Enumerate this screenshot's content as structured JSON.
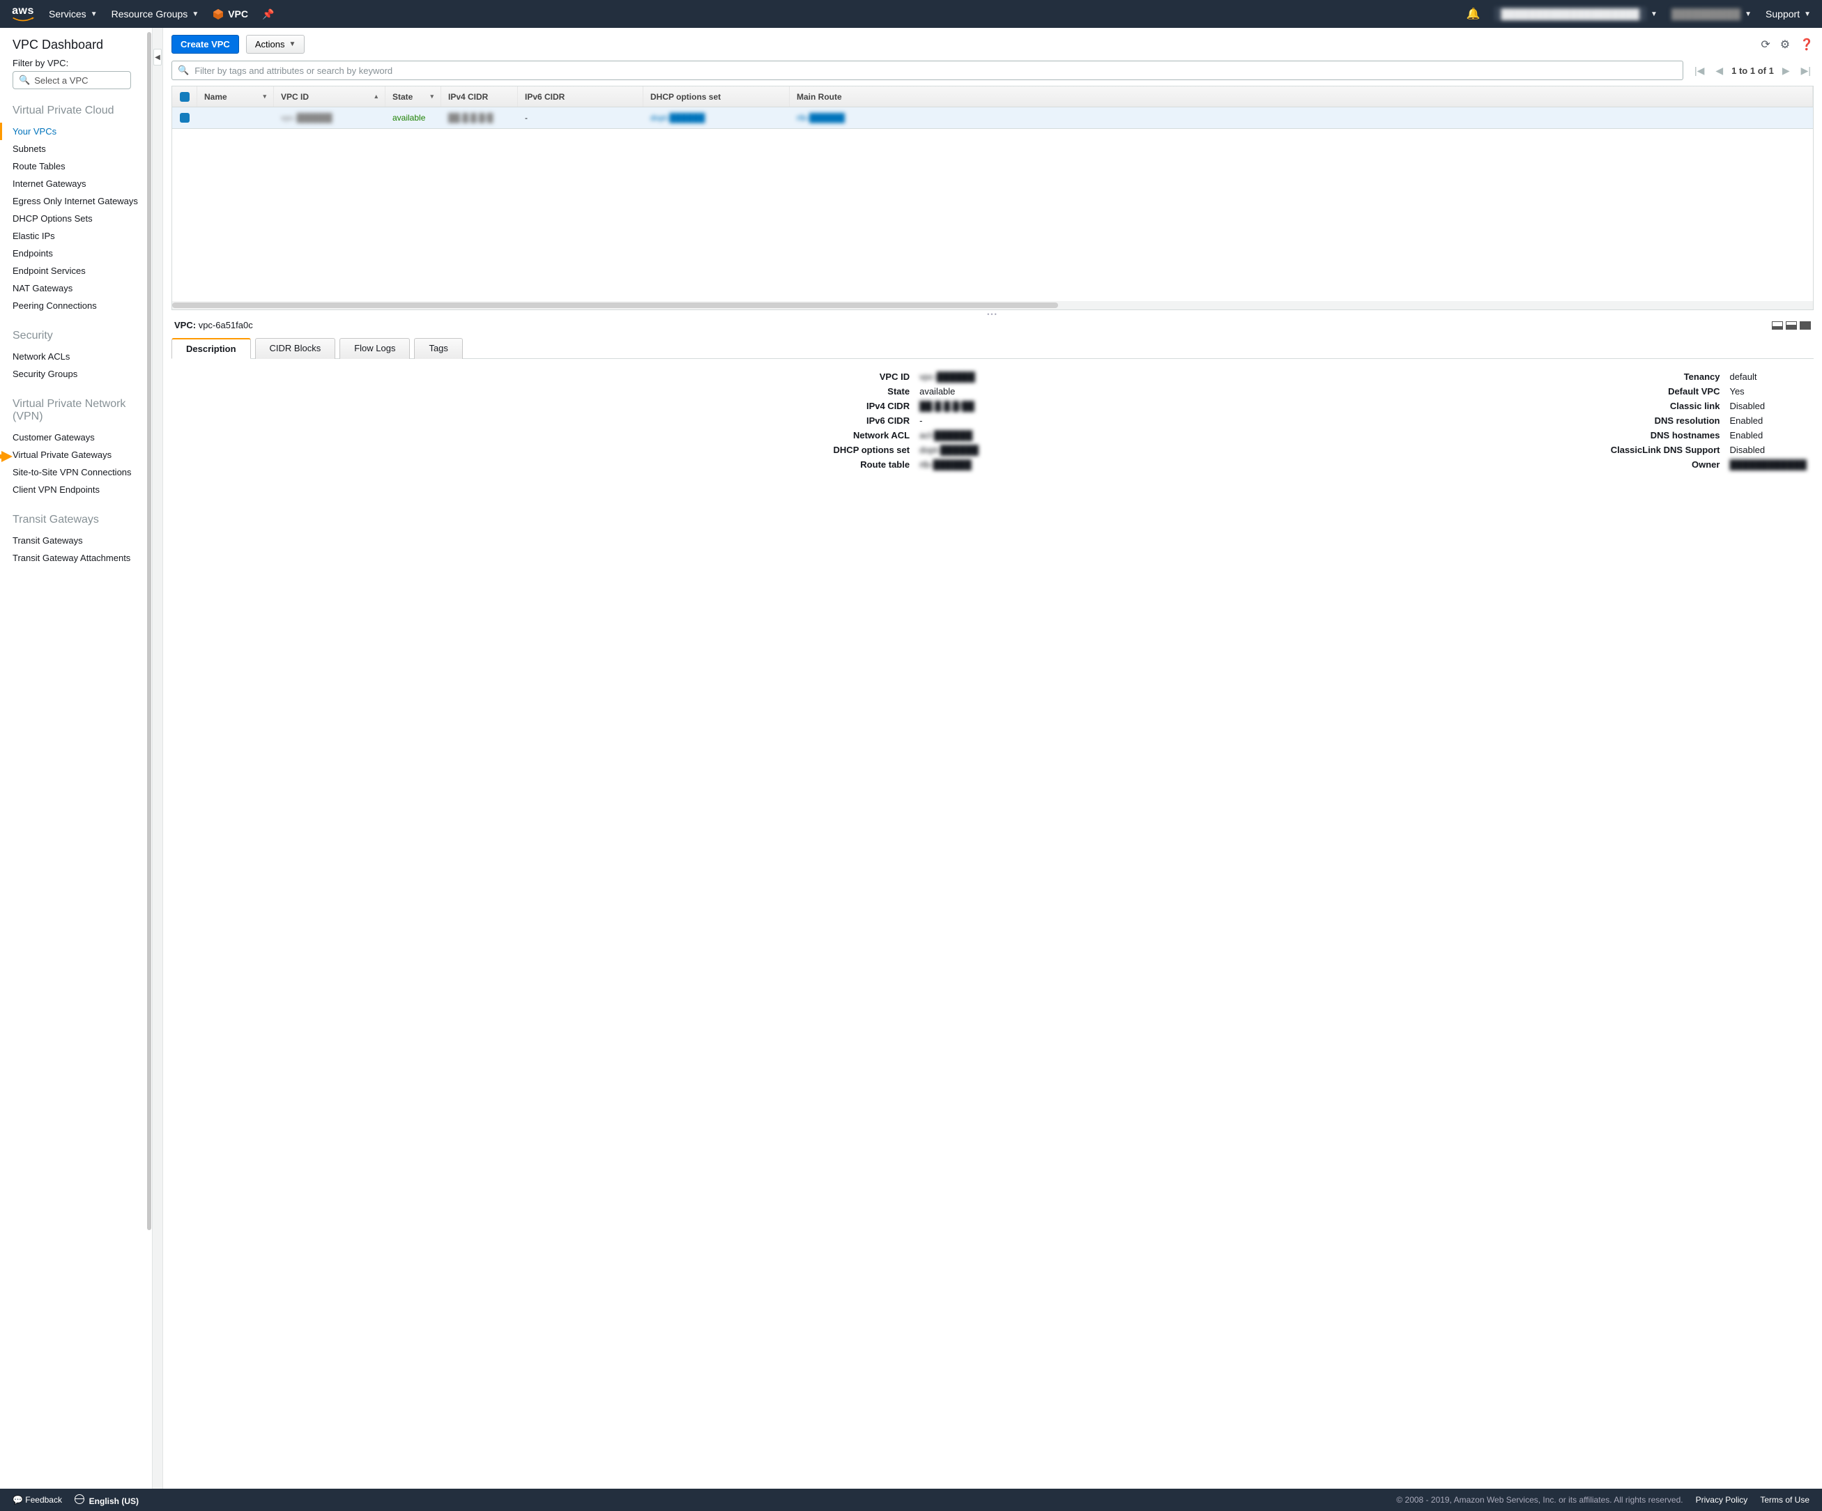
{
  "topnav": {
    "logo": "aws",
    "services": "Services",
    "resource_groups": "Resource Groups",
    "service_label": "VPC",
    "account_text": "████████████████████",
    "region_text": "██████████",
    "support": "Support"
  },
  "sidebar": {
    "title": "VPC Dashboard",
    "filter_label": "Filter by VPC:",
    "select_placeholder": "Select a VPC",
    "groups": {
      "vpc": {
        "title": "Virtual Private Cloud",
        "items": [
          "Your VPCs",
          "Subnets",
          "Route Tables",
          "Internet Gateways",
          "Egress Only Internet Gateways",
          "DHCP Options Sets",
          "Elastic IPs",
          "Endpoints",
          "Endpoint Services",
          "NAT Gateways",
          "Peering Connections"
        ]
      },
      "security": {
        "title": "Security",
        "items": [
          "Network ACLs",
          "Security Groups"
        ]
      },
      "vpn": {
        "title": "Virtual Private Network (VPN)",
        "items": [
          "Customer Gateways",
          "Virtual Private Gateways",
          "Site-to-Site VPN Connections",
          "Client VPN Endpoints"
        ]
      },
      "tgw": {
        "title": "Transit Gateways",
        "items": [
          "Transit Gateways",
          "Transit Gateway Attachments"
        ]
      }
    },
    "active": "Your VPCs",
    "arrow_target": "Virtual Private Gateways"
  },
  "actions": {
    "create": "Create VPC",
    "actions": "Actions"
  },
  "search": {
    "placeholder": "Filter by tags and attributes or search by keyword"
  },
  "pager": {
    "text": "1 to 1 of 1"
  },
  "table": {
    "headers": [
      "Name",
      "VPC ID",
      "State",
      "IPv4 CIDR",
      "IPv6 CIDR",
      "DHCP options set",
      "Main Route"
    ],
    "rows": [
      {
        "name": "",
        "vpc_id": "vpc-██████",
        "state": "available",
        "ipv4": "██.█.█.█/█",
        "ipv6": "-",
        "dhcp": "dopt-██████",
        "route": "rtb-██████"
      }
    ]
  },
  "detail": {
    "header_label": "VPC:",
    "header_value": "vpc-6a51fa0c",
    "tabs": [
      "Description",
      "CIDR Blocks",
      "Flow Logs",
      "Tags"
    ],
    "active_tab": "Description",
    "left": {
      "VPC ID": "vpc-██████",
      "State": "available",
      "IPv4 CIDR": "██.█.█.█/██",
      "IPv6 CIDR": "-",
      "Network ACL": "acl-██████",
      "DHCP options set": "dopt-██████",
      "Route table": "rtb-██████"
    },
    "right": {
      "Tenancy": "default",
      "Default VPC": "Yes",
      "Classic link": "Disabled",
      "DNS resolution": "Enabled",
      "DNS hostnames": "Enabled",
      "ClassicLink DNS Support": "Disabled",
      "Owner": "████████████"
    }
  },
  "footer": {
    "feedback": "Feedback",
    "language": "English (US)",
    "copyright": "© 2008 - 2019, Amazon Web Services, Inc. or its affiliates. All rights reserved.",
    "privacy": "Privacy Policy",
    "terms": "Terms of Use"
  }
}
